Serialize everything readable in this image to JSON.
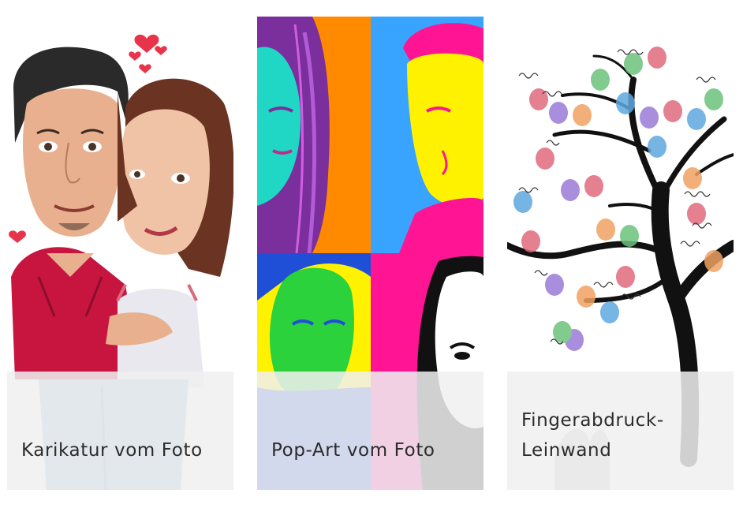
{
  "cards": [
    {
      "title": "Karikatur vom Foto",
      "image": "caricature-couple-illustration"
    },
    {
      "title": "Pop-Art vom Foto",
      "image": "pop-art-four-panel-portrait"
    },
    {
      "title": "Fingerabdruck-Leinwand",
      "image": "fingerprint-tree-canvas"
    }
  ],
  "colors": {
    "caption_overlay": "#f0f0f0",
    "caption_text": "#2b2b2b",
    "popart_orange": "#ff8a00",
    "popart_blue": "#39a4ff",
    "popart_magenta": "#ff1493",
    "popart_yellow": "#fff200"
  }
}
